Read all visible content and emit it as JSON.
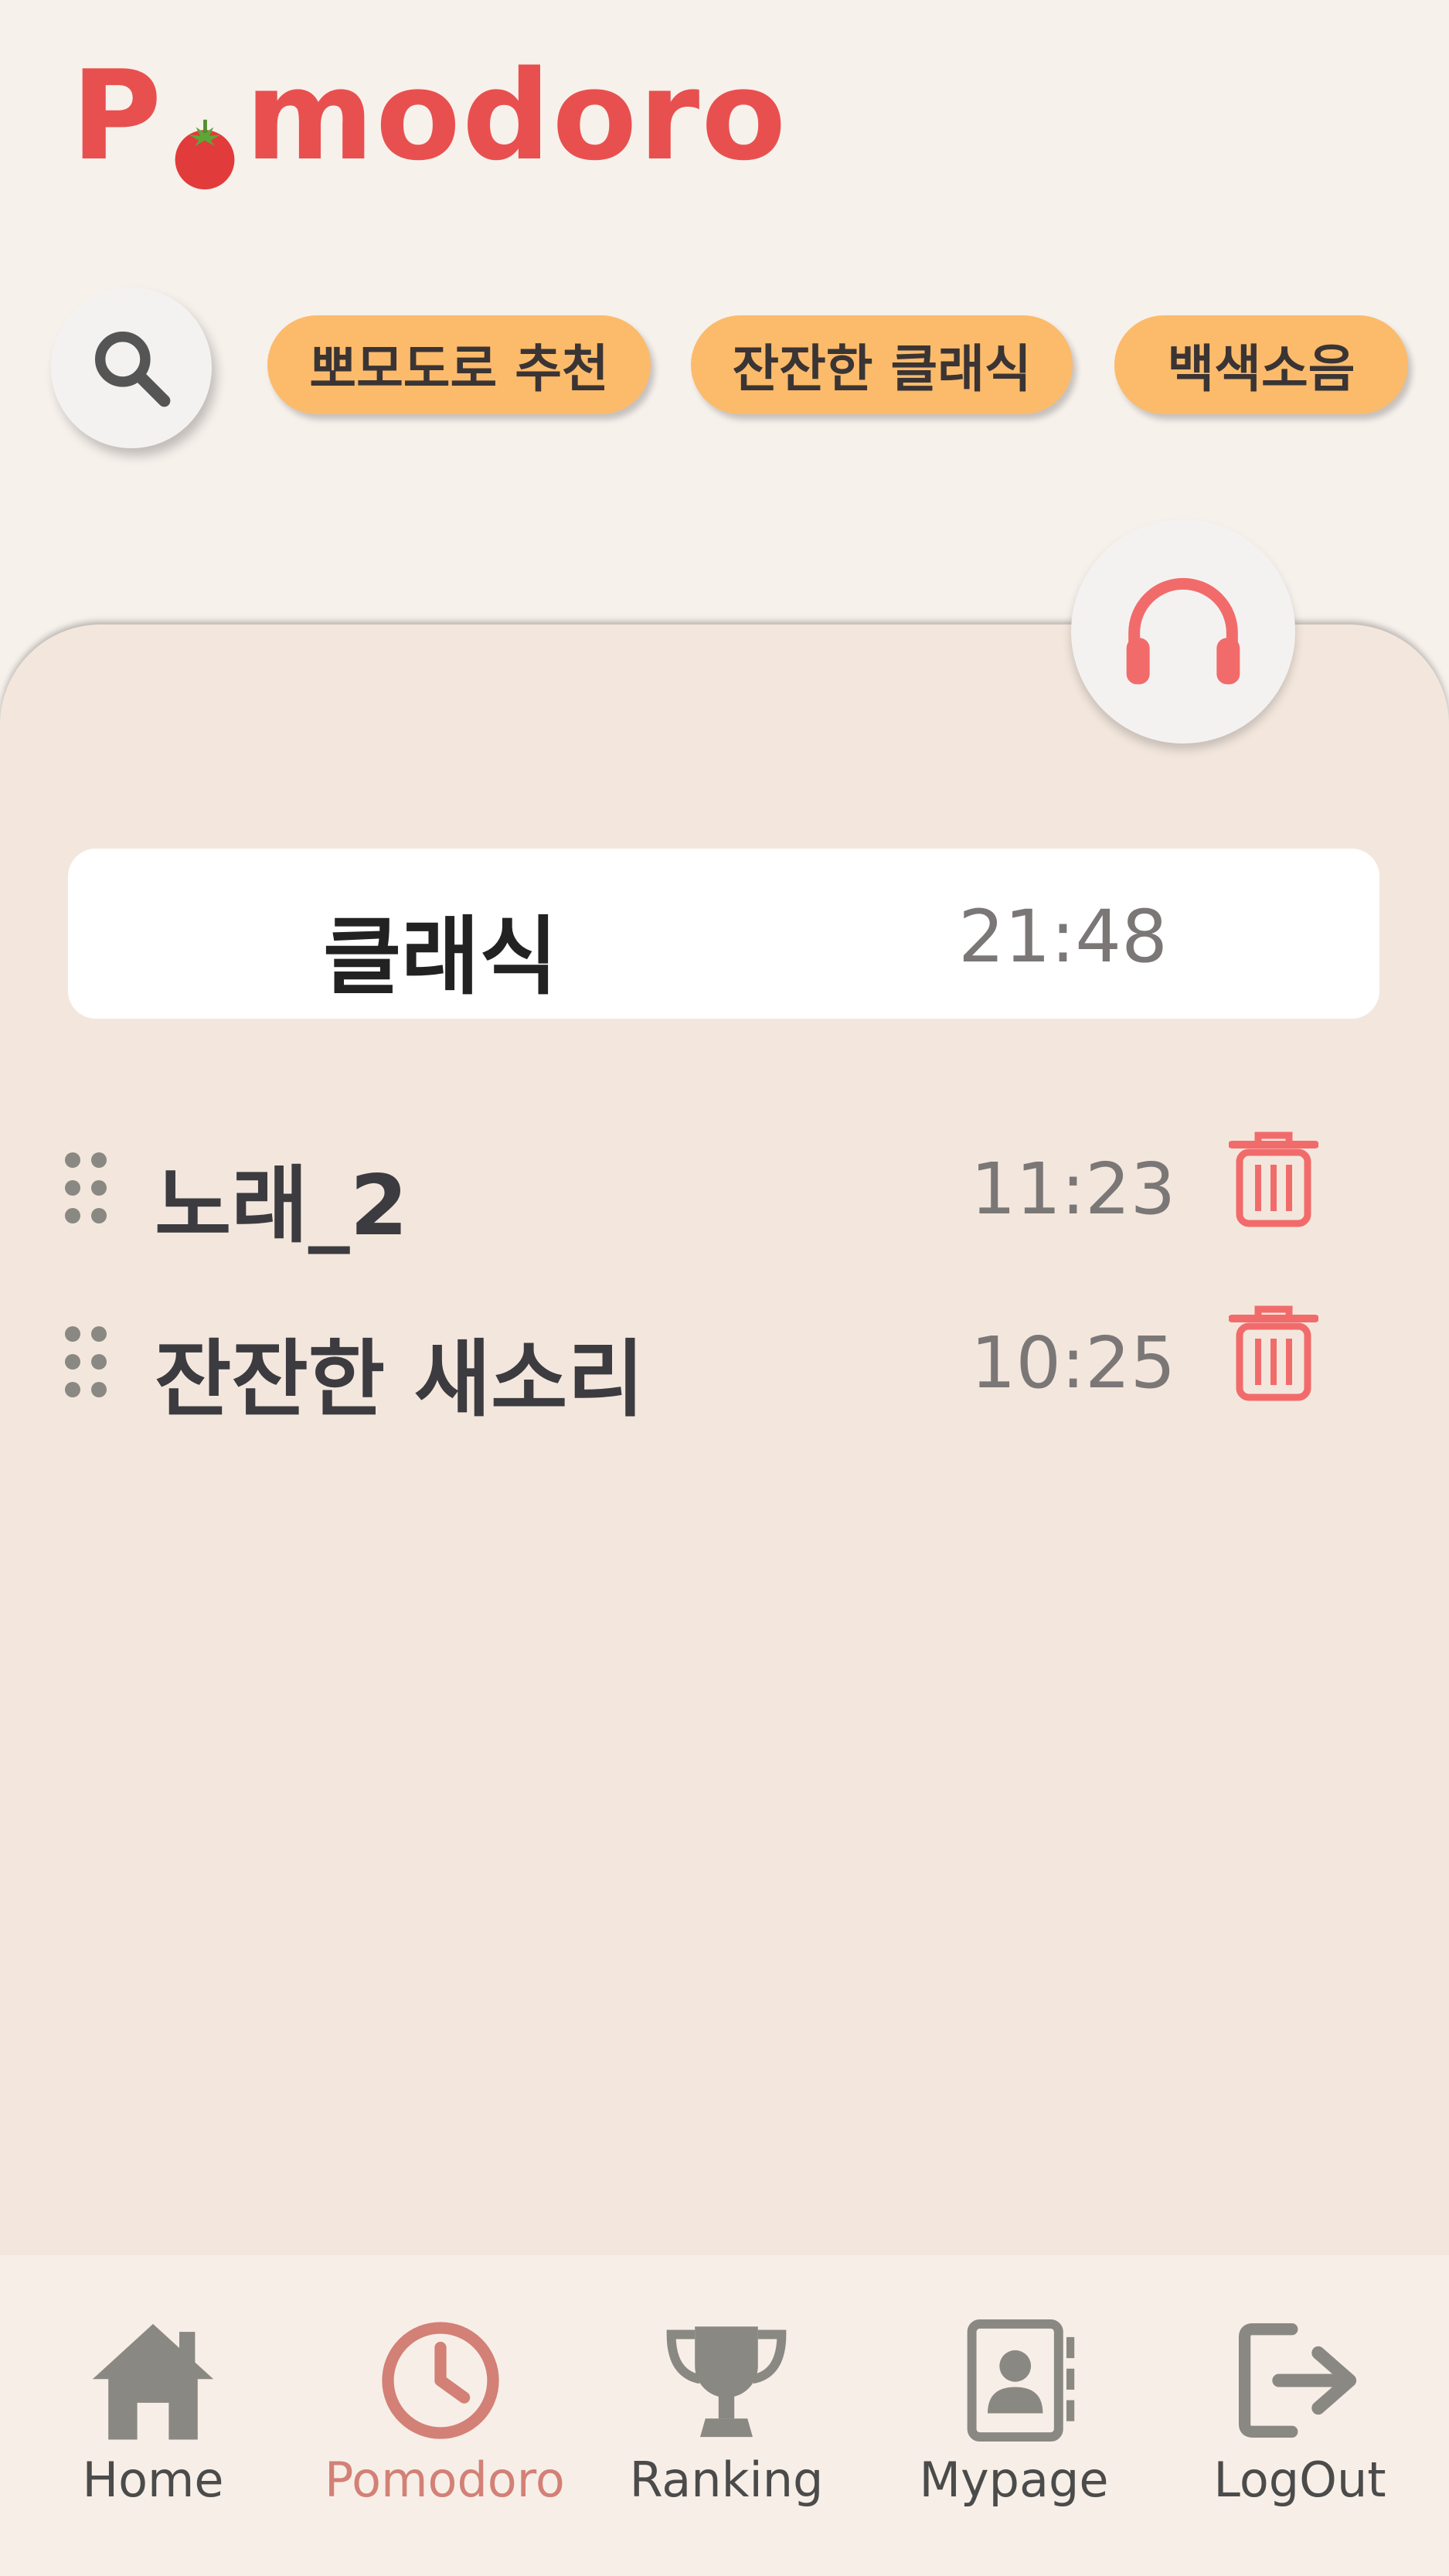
{
  "app": {
    "logo_prefix": "P",
    "logo_suffix": "modoro",
    "brand_color": "#e8504f"
  },
  "chips": [
    "뽀모도로 추천",
    "잔잔한 클래식",
    "백색소음"
  ],
  "now_playing": {
    "title": "클래식",
    "time": "21:48"
  },
  "tracks": [
    {
      "title": "노래_2",
      "time": "11:23"
    },
    {
      "title": "잔잔한 새소리",
      "time": "10:25"
    }
  ],
  "tabs": [
    {
      "label": "Home",
      "icon": "home-icon"
    },
    {
      "label": "Pomodoro",
      "icon": "clock-icon",
      "active": true
    },
    {
      "label": "Ranking",
      "icon": "trophy-icon"
    },
    {
      "label": "Mypage",
      "icon": "contact-book-icon"
    },
    {
      "label": "LogOut",
      "icon": "logout-icon"
    }
  ],
  "colors": {
    "accent_chip": "#fcbb6b",
    "panel_bg": "#f3e7dd",
    "icon_red": "#f26b6b",
    "active_tab": "#d38077",
    "inactive_tab": "#8a8882"
  }
}
